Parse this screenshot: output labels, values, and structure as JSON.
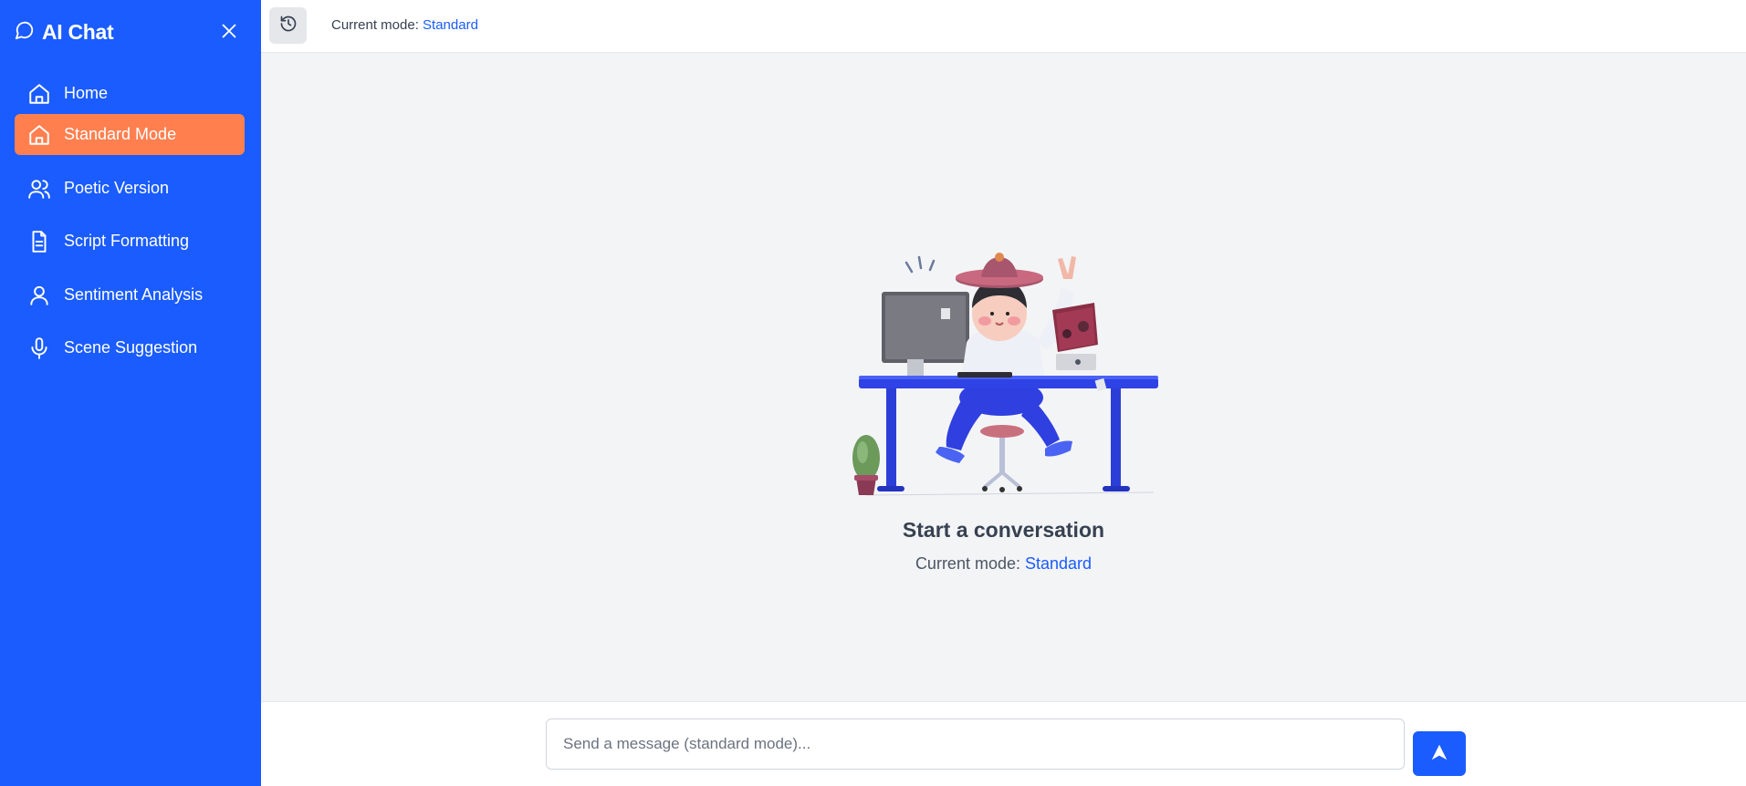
{
  "sidebar": {
    "title": "AI Chat",
    "title_icon": "chat-bubble-icon",
    "close_icon": "close-icon",
    "items": [
      {
        "label": "Home",
        "icon": "home-icon",
        "active": false
      },
      {
        "label": "Standard Mode",
        "icon": "home-icon",
        "active": true
      },
      {
        "label": "Poetic Version",
        "icon": "users-icon",
        "active": false
      },
      {
        "label": "Script Formatting",
        "icon": "document-icon",
        "active": false
      },
      {
        "label": "Sentiment Analysis",
        "icon": "user-icon",
        "active": false
      },
      {
        "label": "Scene Suggestion",
        "icon": "microphone-icon",
        "active": false
      }
    ]
  },
  "header": {
    "history_icon": "history-icon",
    "mode_prefix": "Current mode: ",
    "mode_value": "Standard"
  },
  "empty_state": {
    "title": "Start a conversation",
    "mode_prefix": "Current mode: ",
    "mode_value": "Standard"
  },
  "composer": {
    "placeholder": "Send a message (standard mode)...",
    "value": "",
    "send_icon": "send-arrow-icon"
  },
  "colors": {
    "sidebar_bg": "#1a5cff",
    "active_item_bg": "#ff7f4f",
    "accent": "#1a5cff",
    "page_bg": "#f3f4f6"
  }
}
